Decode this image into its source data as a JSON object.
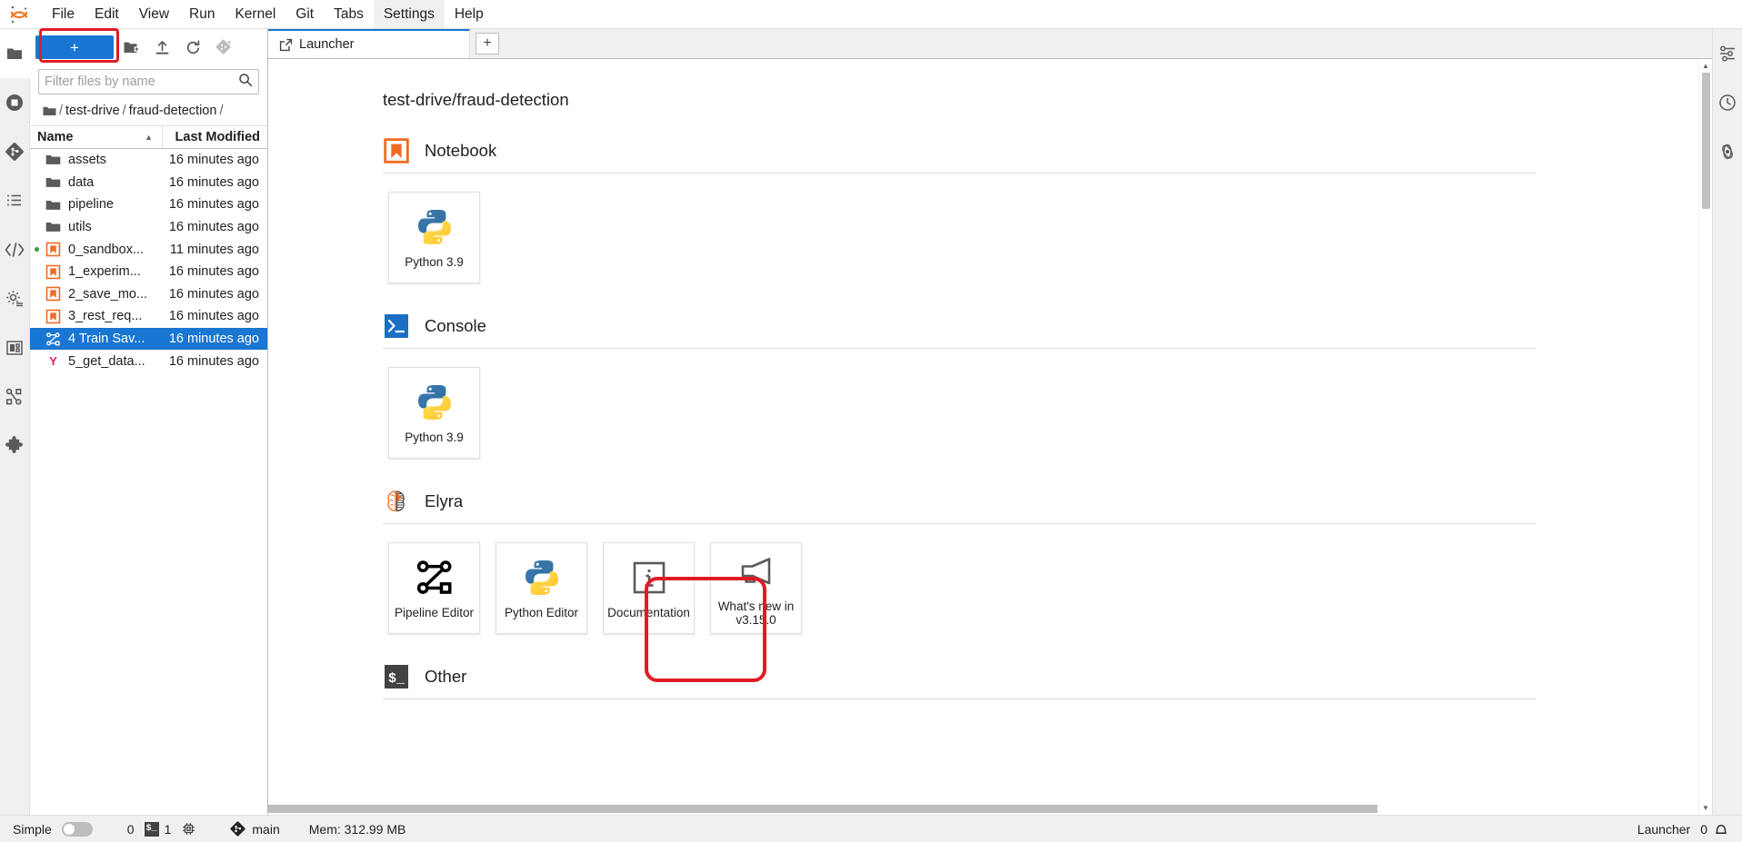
{
  "menubar": {
    "logo_icon": "jupyter-logo-icon",
    "items": [
      {
        "label": "File",
        "active": false
      },
      {
        "label": "Edit",
        "active": false
      },
      {
        "label": "View",
        "active": false
      },
      {
        "label": "Run",
        "active": false
      },
      {
        "label": "Kernel",
        "active": false
      },
      {
        "label": "Git",
        "active": false
      },
      {
        "label": "Tabs",
        "active": false
      },
      {
        "label": "Settings",
        "active": true
      },
      {
        "label": "Help",
        "active": false
      }
    ]
  },
  "left_activity_bar": {
    "items": [
      {
        "name": "file-browser-icon",
        "selected": true
      },
      {
        "name": "running-terminals-icon",
        "selected": false
      },
      {
        "name": "git-icon",
        "selected": false
      },
      {
        "name": "table-of-contents-icon",
        "selected": false
      },
      {
        "name": "code-snippets-icon",
        "selected": false
      },
      {
        "name": "runtimes-gear-icon",
        "selected": false
      },
      {
        "name": "component-catalogs-icon",
        "selected": false
      },
      {
        "name": "pipeline-components-icon",
        "selected": false
      },
      {
        "name": "extension-manager-icon",
        "selected": false
      }
    ]
  },
  "right_activity_bar": {
    "items": [
      {
        "name": "property-inspector-icon"
      },
      {
        "name": "debugger-icon"
      },
      {
        "name": "kernel-inspector-icon"
      }
    ]
  },
  "filebrowser": {
    "new_launcher_label": "+",
    "toolbar_icons": [
      "new-folder-icon",
      "upload-icon",
      "refresh-icon",
      "new-checkpoint-icon"
    ],
    "filter": {
      "placeholder": "Filter files by name",
      "value": "",
      "icon": "search-icon"
    },
    "breadcrumb": {
      "root_icon": "folder-icon",
      "parts": [
        "test-drive",
        "fraud-detection"
      ],
      "separator": "/"
    },
    "columns": {
      "name": "Name",
      "last_modified": "Last Modified",
      "sort_arrow": "▲"
    },
    "rows": [
      {
        "name": "assets",
        "modified": "16 minutes ago",
        "icon": "folder-icon",
        "selected": false,
        "running": false
      },
      {
        "name": "data",
        "modified": "16 minutes ago",
        "icon": "folder-icon",
        "selected": false,
        "running": false
      },
      {
        "name": "pipeline",
        "modified": "16 minutes ago",
        "icon": "folder-icon",
        "selected": false,
        "running": false
      },
      {
        "name": "utils",
        "modified": "16 minutes ago",
        "icon": "folder-icon",
        "selected": false,
        "running": false
      },
      {
        "name": "0_sandbox...",
        "modified": "11 minutes ago",
        "icon": "notebook-icon",
        "selected": false,
        "running": true
      },
      {
        "name": "1_experim...",
        "modified": "16 minutes ago",
        "icon": "notebook-icon",
        "selected": false,
        "running": false
      },
      {
        "name": "2_save_mo...",
        "modified": "16 minutes ago",
        "icon": "notebook-icon",
        "selected": false,
        "running": false
      },
      {
        "name": "3_rest_req...",
        "modified": "16 minutes ago",
        "icon": "notebook-icon",
        "selected": false,
        "running": false
      },
      {
        "name": "4 Train Sav...",
        "modified": "16 minutes ago",
        "icon": "pipeline-icon",
        "selected": true,
        "running": false
      },
      {
        "name": "5_get_data...",
        "modified": "16 minutes ago",
        "icon": "yaml-icon",
        "selected": false,
        "running": false
      }
    ]
  },
  "tabbar": {
    "tabs": [
      {
        "label": "Launcher",
        "icon": "launcher-icon",
        "active": true
      }
    ],
    "add_tab_label": "+"
  },
  "launcher": {
    "title": "test-drive/fraud-detection",
    "sections": [
      {
        "title": "Notebook",
        "icon": "notebook-icon",
        "cards": [
          {
            "label": "Python 3.9",
            "icon": "python-icon"
          }
        ]
      },
      {
        "title": "Console",
        "icon": "console-icon",
        "cards": [
          {
            "label": "Python 3.9",
            "icon": "python-icon"
          }
        ]
      },
      {
        "title": "Elyra",
        "icon": "elyra-brain-icon",
        "cards": [
          {
            "label": "Pipeline Editor",
            "icon": "pipeline-icon",
            "highlighted": true
          },
          {
            "label": "Python Editor",
            "icon": "python-icon",
            "highlighted": false
          },
          {
            "label": "Documentation",
            "icon": "info-icon",
            "highlighted": false
          },
          {
            "label": "What's new in\nv3.15.0",
            "icon": "megaphone-icon",
            "highlighted": false
          }
        ]
      },
      {
        "title": "Other",
        "icon": "terminal-icon",
        "cards": []
      }
    ]
  },
  "statusbar": {
    "simple_label": "Simple",
    "simple_toggle_on": false,
    "kernel_count": "0",
    "terminal_badge": "$_",
    "terminal_count": "1",
    "cpu_icon": "cpu-icon",
    "git_icon": "git-icon",
    "branch": "main",
    "memory": "Mem: 312.99 MB",
    "active_tab": "Launcher",
    "notification_count": "0",
    "notification_icon": "bell-icon"
  },
  "colors": {
    "accent_blue": "#1976d2",
    "highlight_red": "#e01b24",
    "elyra_orange": "#ef6c23",
    "running_green": "#3c9a3c",
    "yaml_pink": "#e91e63"
  }
}
